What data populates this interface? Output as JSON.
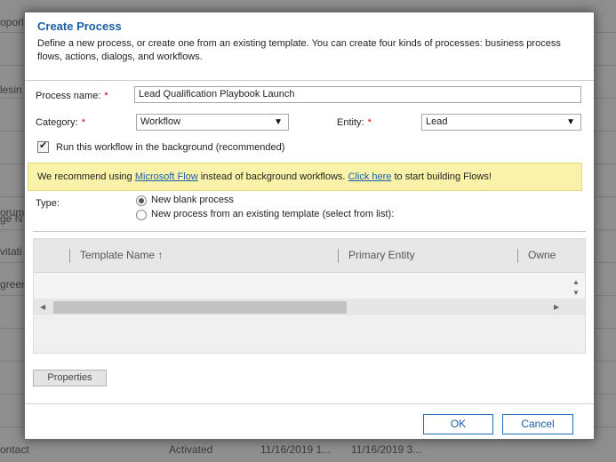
{
  "background": {
    "row_fragments": [
      "oporl",
      "lesin",
      "orum",
      "ge N",
      "vitati",
      "green"
    ],
    "bottom_row": {
      "name": "ontact",
      "status": "Activated",
      "date1": "11/16/2019 1...",
      "date2": "11/16/2019 3..."
    }
  },
  "dialog": {
    "title": "Create Process",
    "description": "Define a new process, or create one from an existing template. You can create four kinds of processes: business process flows, actions, dialogs, and workflows.",
    "process_name_label": "Process name:",
    "process_name_value": "Lead Qualification Playbook Launch",
    "category_label": "Category:",
    "category_value": "Workflow",
    "entity_label": "Entity:",
    "entity_value": "Lead",
    "required_mark": "*",
    "background_checkbox_label": "Run this workflow in the background (recommended)",
    "background_checked": true,
    "banner": {
      "text_before": "We recommend using ",
      "link1": "Microsoft Flow",
      "text_middle": " instead of background workflows. ",
      "link2": "Click here",
      "text_after": " to start building Flows!"
    },
    "type_label": "Type:",
    "type_options": [
      "New blank process",
      "New process from an existing template (select from list):"
    ],
    "type_selected": "New blank process",
    "grid_columns": [
      "Template Name ↑",
      "Primary Entity",
      "Owne"
    ],
    "properties_label": "Properties",
    "ok_label": "OK",
    "cancel_label": "Cancel"
  },
  "colors": {
    "title_blue": "#1a5fa8",
    "banner_yellow": "#fbf2a9",
    "required_red": "#cc0000"
  }
}
